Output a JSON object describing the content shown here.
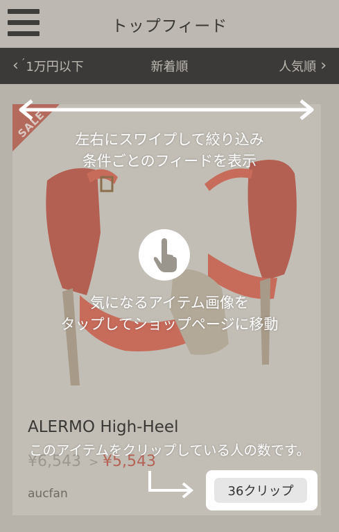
{
  "header": {
    "title": "トップフィード"
  },
  "filterbar": {
    "prev_label": "1万円以下",
    "current_label": "新着順",
    "next_label": "人気順"
  },
  "product": {
    "badge": "SALE",
    "name": "ALERMO High-Heel",
    "price_old": "¥6,543",
    "price_arrow": ">",
    "price_new": "¥5,543",
    "store": "aucfan"
  },
  "clip": {
    "label": "36クリップ"
  },
  "tutorial": {
    "swipe_hint": [
      "左右にスワイプして絞り込み",
      "条件ごとのフィードを表示"
    ],
    "tap_hint": [
      "気になるアイテム画像を",
      "タップしてショップページに移動"
    ],
    "clip_hint": "このアイテムをクリップしている人の数です。"
  },
  "icons": {
    "menu": "hamburger-icon",
    "prev": "chevron-left-icon",
    "next": "chevron-right-icon",
    "swipe": "double-arrow-icon",
    "tap": "hand-pointer-icon",
    "pointer": "arrow-right-icon"
  },
  "colors": {
    "overlay": "#b7b3ab",
    "filterbar": "#3b3a38",
    "price_new": "#b46356",
    "shoe": "#c76b5b"
  }
}
